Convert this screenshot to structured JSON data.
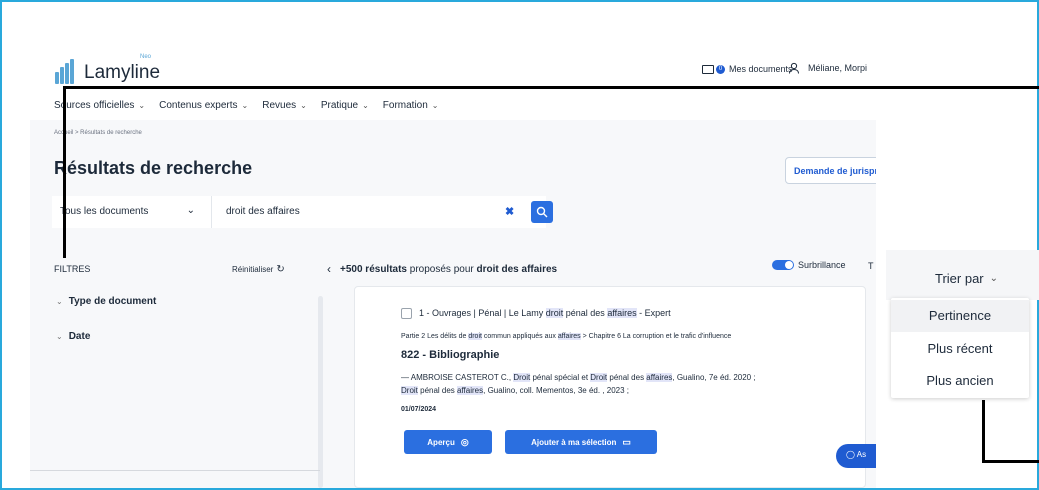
{
  "header": {
    "logo_text": "Lamyline",
    "logo_sub": "Neo",
    "documents_label": "Mes documents",
    "documents_count": "0",
    "user_label": "Méliane, Morpi"
  },
  "nav": {
    "items": [
      {
        "label": "Sources officielles"
      },
      {
        "label": "Contenus experts"
      },
      {
        "label": "Revues"
      },
      {
        "label": "Pratique"
      },
      {
        "label": "Formation"
      }
    ]
  },
  "breadcrumb": "Accueil > Résultats de recherche",
  "page_title": "Résultats de recherche",
  "juris_button": "Demande de jurispr",
  "search": {
    "scope": "Tous les documents",
    "query": "droit des affaires"
  },
  "filters": {
    "title": "FILTRES",
    "reset": "Réinitialiser",
    "groups": [
      {
        "label": "Type de document"
      },
      {
        "label": "Date"
      }
    ]
  },
  "results": {
    "count": "+500 résultats",
    "middle": " proposés pour ",
    "query": "droit des affaires",
    "highlight_label": "Surbrillance",
    "extra": "T"
  },
  "card": {
    "crumb_a": "1 - Ouvrages | Pénal | Le Lamy ",
    "crumb_b": "droit",
    "crumb_c": " pénal des ",
    "crumb_d": "affaires",
    "crumb_e": " - Expert",
    "path_a": "Partie 2 Les délits de ",
    "path_b": "droit",
    "path_c": " commun appliqués aux ",
    "path_d": "affaires",
    "path_e": " > Chapitre 6 La corruption et le trafic d'influence",
    "title": "822 - Bibliographie",
    "desc_a": "— AMBROISE CASTEROT C., ",
    "desc_b": "Droit",
    "desc_c": " pénal spécial et ",
    "desc_d": "Droit",
    "desc_e": " pénal des ",
    "desc_f": "affaires",
    "desc_g": ", Gualino, 7e éd. 2020 ;",
    "desc_h": "Droit",
    "desc_i": " pénal des ",
    "desc_j": "affaires",
    "desc_k": ", Gualino, coll. Mementos, 3e éd. , 2023 ;",
    "date": "01/07/2024",
    "btn_apercu": "Aperçu",
    "btn_ajout": "Ajouter à ma sélection"
  },
  "assist_label": "As",
  "sort": {
    "label": "Trier par",
    "options": [
      "Pertinence",
      "Plus récent",
      "Plus ancien"
    ],
    "selected": "Pertinence"
  },
  "colors": {
    "accent": "#2b6fe0",
    "frame": "#29a9dc",
    "highlight": "#e2e5f8"
  }
}
